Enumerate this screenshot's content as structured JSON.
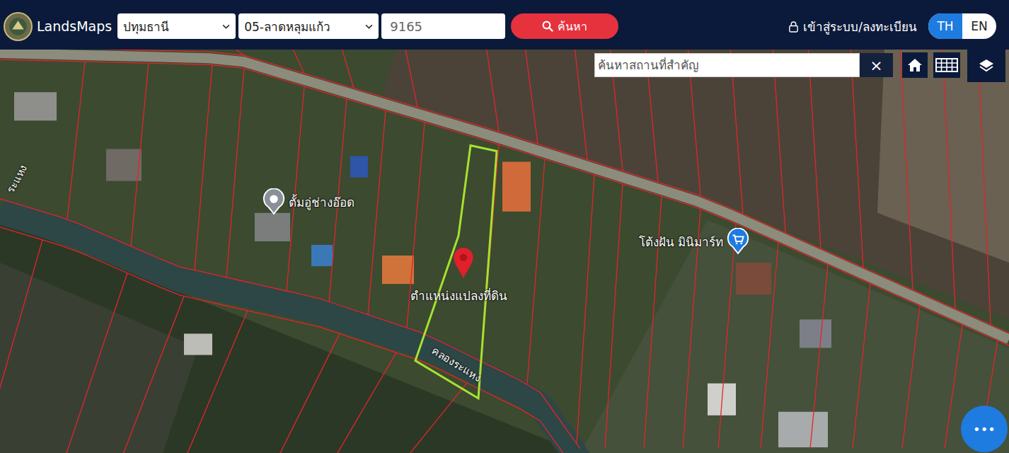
{
  "header": {
    "logo": "LandsMaps",
    "province": "ปทุมธานี",
    "district": "05-ลาดหลุมแก้ว",
    "parcel_number": "9165",
    "search_button": "ค้นหา",
    "login": "เข้าสู่ระบบ/ลงทะเบียน",
    "languages": [
      {
        "label": "TH",
        "selected": true
      },
      {
        "label": "EN",
        "selected": false
      }
    ]
  },
  "map": {
    "place_search": {
      "placeholder": "ค้นหาสถานที่สำคัญ",
      "clear": "×"
    },
    "parcel_marker": "ตำแหน่งแปลงที่ดิน",
    "places": [
      {
        "name": "ตั้มอู่ช่างอ๊อด",
        "kind": "place"
      },
      {
        "name": "โต้งฝัน มินิมาร์ท",
        "kind": "shop"
      }
    ],
    "waterways": [
      {
        "name": "คลองระแหง"
      },
      {
        "name": "ระแหง"
      }
    ],
    "menu": "•••"
  }
}
